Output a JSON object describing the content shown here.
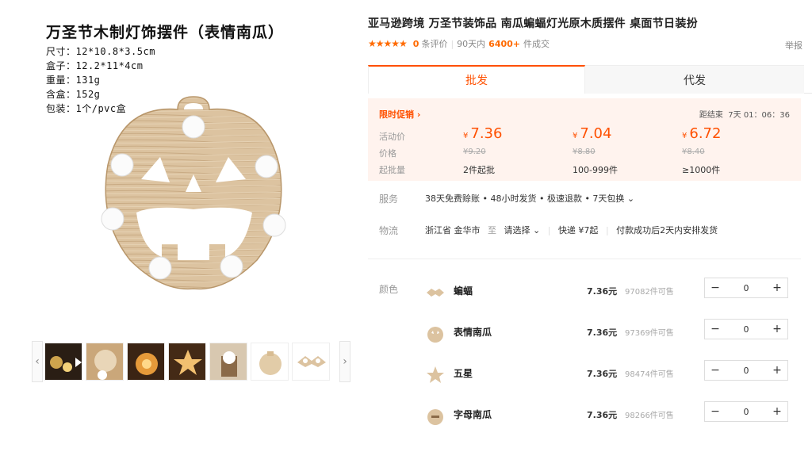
{
  "product_image": {
    "spec_title": "万圣节木制灯饰摆件（表情南瓜）",
    "specs": [
      "尺寸：12*10.8*3.5cm",
      "盒子：12.2*11*4cm",
      "重量：131g",
      "含盒：152g",
      "包装：1个/pvc盒"
    ]
  },
  "thumbnails": {
    "prev": "‹",
    "next": "›",
    "items": [
      "thumb-1",
      "thumb-2",
      "thumb-3",
      "thumb-4",
      "thumb-5",
      "thumb-6",
      "thumb-7"
    ]
  },
  "header": {
    "title": "亚马逊跨境 万圣节装饰品 南瓜蝙蝠灯光原木质摆件 桌面节日装扮",
    "report": "举报",
    "stars": "★★★★★",
    "review_count": "0",
    "review_label": "条评价",
    "sep": "|",
    "sold_prefix": "90天内",
    "sold_count": "6400+",
    "sold_suffix": "件成交"
  },
  "tabs": {
    "wholesale": "批发",
    "dropship": "代发"
  },
  "price": {
    "promo_label": "限时促销 ›",
    "countdown_label": "距结束",
    "countdown": "7天 01：06：36",
    "row_labels": {
      "activity": "活动价",
      "price": "价格",
      "moq": "起批量"
    },
    "currency": "¥",
    "tiers": [
      {
        "activity": "7.36",
        "original": "¥9.20",
        "moq": "2件起批"
      },
      {
        "activity": "7.04",
        "original": "¥8.80",
        "moq": "100-999件"
      },
      {
        "activity": "6.72",
        "original": "¥8.40",
        "moq": "≥1000件"
      }
    ]
  },
  "service": {
    "label": "服务",
    "value": "38天免费赊账 • 48小时发货 • 极速退款 • 7天包换 ⌄"
  },
  "logistics": {
    "label": "物流",
    "from": "浙江省 金华市",
    "to_word": "至",
    "destination": "请选择 ⌄",
    "shipping": "快递 ¥7起",
    "dispatch": "付款成功后2天内安排发货"
  },
  "sku": {
    "label": "颜色",
    "minus": "−",
    "plus": "+",
    "items": [
      {
        "name": "蝙蝠",
        "price": "7.36元",
        "stock": "97082件可售",
        "qty": "0"
      },
      {
        "name": "表情南瓜",
        "price": "7.36元",
        "stock": "97369件可售",
        "qty": "0"
      },
      {
        "name": "五星",
        "price": "7.36元",
        "stock": "98474件可售",
        "qty": "0"
      },
      {
        "name": "字母南瓜",
        "price": "7.36元",
        "stock": "98266件可售",
        "qty": "0"
      }
    ]
  },
  "colors": {
    "accent": "#ff5000",
    "wood": "#d9bf9a"
  }
}
